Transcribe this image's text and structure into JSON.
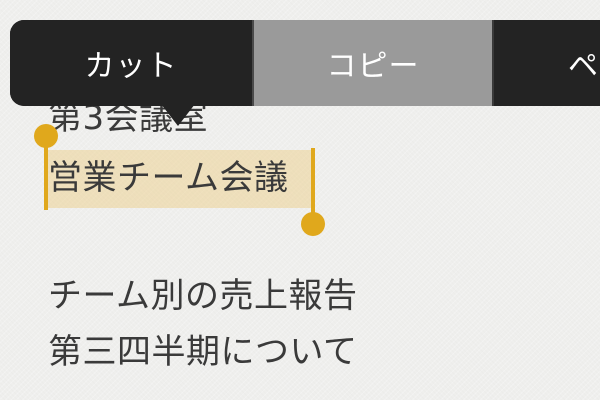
{
  "edit_menu": {
    "cut_label": "カット",
    "copy_label": "コピー",
    "paste_label": "ペ"
  },
  "note": {
    "lines": [
      "第3会議室",
      "営業チーム会議",
      "チーム別の売上報告",
      "第三四半期について"
    ],
    "selected_text": "営業チーム会議"
  },
  "colors": {
    "menu_background": "#232323",
    "menu_highlight": "#9a9a9a",
    "selection_handle": "#e0a81c",
    "selection_fill": "#ecc878",
    "text": "#3a3a3a"
  }
}
